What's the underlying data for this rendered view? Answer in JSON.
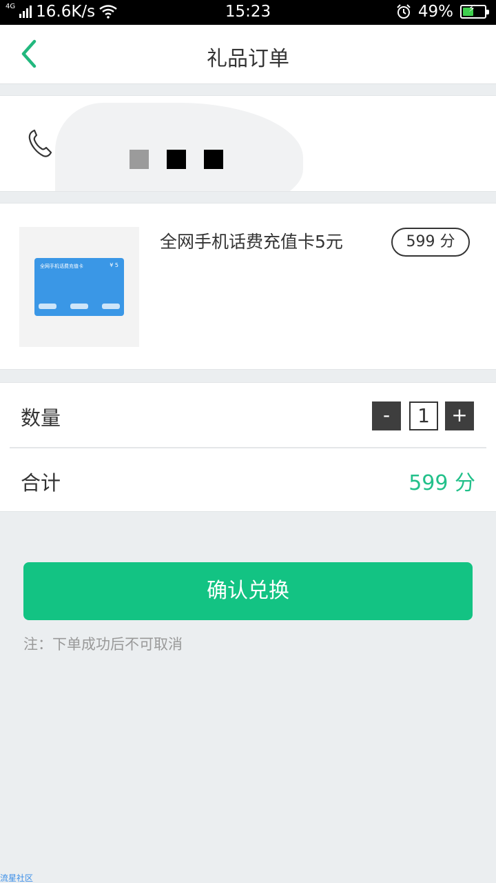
{
  "status_bar": {
    "network": "4G",
    "speed": "16.6K/s",
    "time": "15:23",
    "battery": "49%",
    "battery_level": 0.49
  },
  "nav": {
    "title": "礼品订单"
  },
  "product": {
    "name": "全网手机话费充值卡5元",
    "price": "599 分",
    "card_title": "全网手机话费充值卡",
    "card_price": "¥ 5"
  },
  "order": {
    "quantity_label": "数量",
    "quantity": "1",
    "minus": "-",
    "plus": "+",
    "total_label": "合计",
    "total": "599 分"
  },
  "confirm_label": "确认兑换",
  "note": "注：下单成功后不可取消",
  "watermark": "流星社区",
  "colors": {
    "accent": "#13c383",
    "price_green": "#22c08a",
    "back_green": "#22b87e"
  }
}
